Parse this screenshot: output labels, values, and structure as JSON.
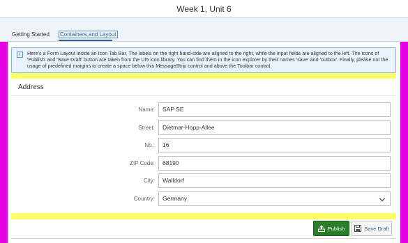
{
  "header": {
    "title": "Week 1, Unit 6"
  },
  "tabs": [
    {
      "label": "Getting Started"
    },
    {
      "label": "Containers and Layout"
    }
  ],
  "message_strip": {
    "text": "Here's a Form Layout inside an Icon Tab Bar. The labels on the right hand-side are aligned to the right, while the input fields are aligned to the left. The icons of 'Publish' and 'Save Draft' button are taken from the UI5 icon library. You can find them in the icon explorer by their names 'save' and 'outbox'. Finally, please not the usage of predefined margins to create a space below this MessageStrip control and above the Toolbar control."
  },
  "form": {
    "title": "Address",
    "fields": [
      {
        "label": "Name:",
        "value": "SAP SE"
      },
      {
        "label": "Street:",
        "value": "Dietmar-Hopp-Allee"
      },
      {
        "label": "No.:",
        "value": "16"
      },
      {
        "label": "ZIP Code:",
        "value": "68190"
      },
      {
        "label": "City:",
        "value": "Walldorf"
      },
      {
        "label": "Country:",
        "value": "Germany"
      }
    ]
  },
  "toolbar": {
    "publish_label": "Publish",
    "save_draft_label": "Save Draft"
  },
  "colors": {
    "margin_marker": "#e600e6",
    "spacing_marker": "#ffff66",
    "publish_button": "#2b7d2b",
    "info_strip": "#eaf3fb"
  },
  "icons": {
    "info": "info-icon",
    "publish": "outbox-icon",
    "save": "save-icon",
    "dropdown": "chevron-down-icon"
  }
}
